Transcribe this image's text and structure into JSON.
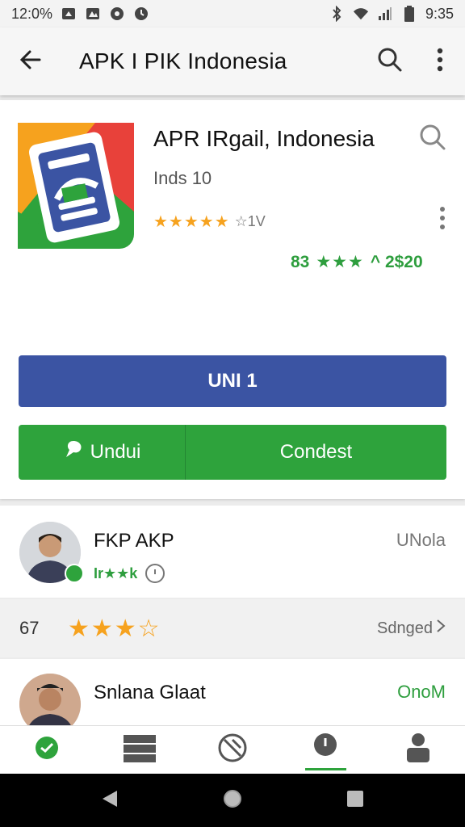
{
  "status_bar": {
    "time_left": "12:0%",
    "time_right": "9:35",
    "icons": [
      "notification-icon",
      "photo-icon",
      "circle-icon",
      "clock-icon",
      "bluetooth-icon",
      "wifi-icon",
      "signal-icon",
      "battery-icon"
    ]
  },
  "app_bar": {
    "title": "APK I PIK Indonesia",
    "back_icon": "arrow-back-icon",
    "search_icon": "search-icon",
    "more_icon": "more-vert-icon"
  },
  "app": {
    "name": "APR IRgail, Indonesia",
    "meta": "Inds 10",
    "stars": "★★★★★",
    "rating_text": "☆1V",
    "green_prefix": "83",
    "green_stars": "★★★",
    "green_value": "^ 2$20",
    "primary_button": "UNI 1",
    "secondary_left": "Undui",
    "secondary_right": "Condest",
    "colors": {
      "primary": "#3b54a3",
      "green": "#2ea33c",
      "star": "#f6a21e"
    }
  },
  "reviews": [
    {
      "name": "FKP AKP",
      "tag": "UNola",
      "sub": "Ir★★k"
    },
    {
      "name": "Snlana Glaat",
      "tag": "OnoM"
    }
  ],
  "rating_strip": {
    "number": "67",
    "stars": "★★★☆",
    "more": "Sdnged"
  },
  "bottom_nav": [
    "chat-icon",
    "storage-icon",
    "compass-icon",
    "download-icon",
    "profile-icon"
  ],
  "system_nav": [
    "back-triangle-icon",
    "home-circle-icon",
    "recents-square-icon"
  ]
}
